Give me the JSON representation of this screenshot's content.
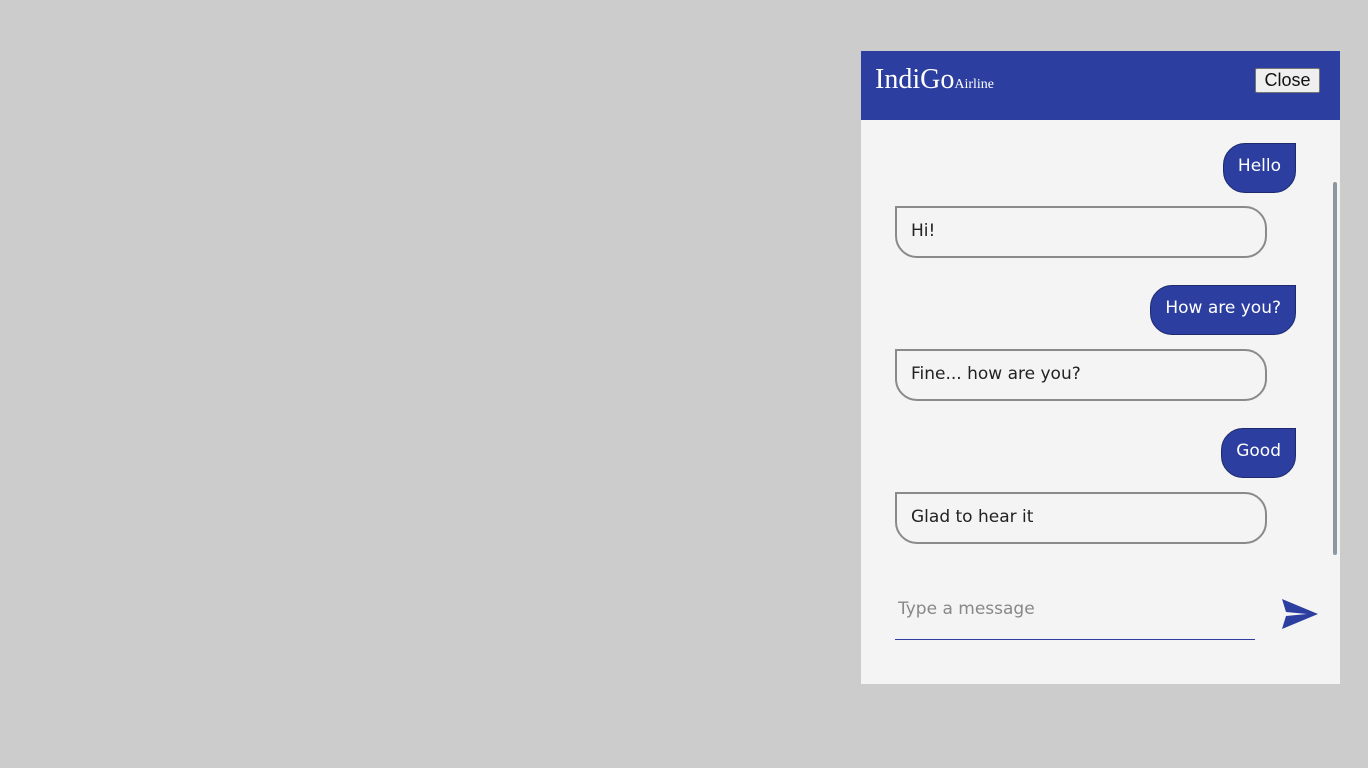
{
  "header": {
    "brand_name": "IndiGo",
    "brand_sub": "Airline",
    "close_label": "Close"
  },
  "messages": [
    {
      "from": "user",
      "text": "Hello"
    },
    {
      "from": "bot",
      "text": "Hi!"
    },
    {
      "from": "user",
      "text": "How are you?"
    },
    {
      "from": "bot",
      "text": "Fine... how are you?"
    },
    {
      "from": "user",
      "text": "Good"
    },
    {
      "from": "bot",
      "text": "Glad to hear it"
    }
  ],
  "composer": {
    "placeholder": "Type a message",
    "value": "",
    "send_icon": "send-icon"
  },
  "colors": {
    "accent": "#2c3e9f",
    "background": "#cccccc",
    "panel": "#f4f4f4"
  }
}
